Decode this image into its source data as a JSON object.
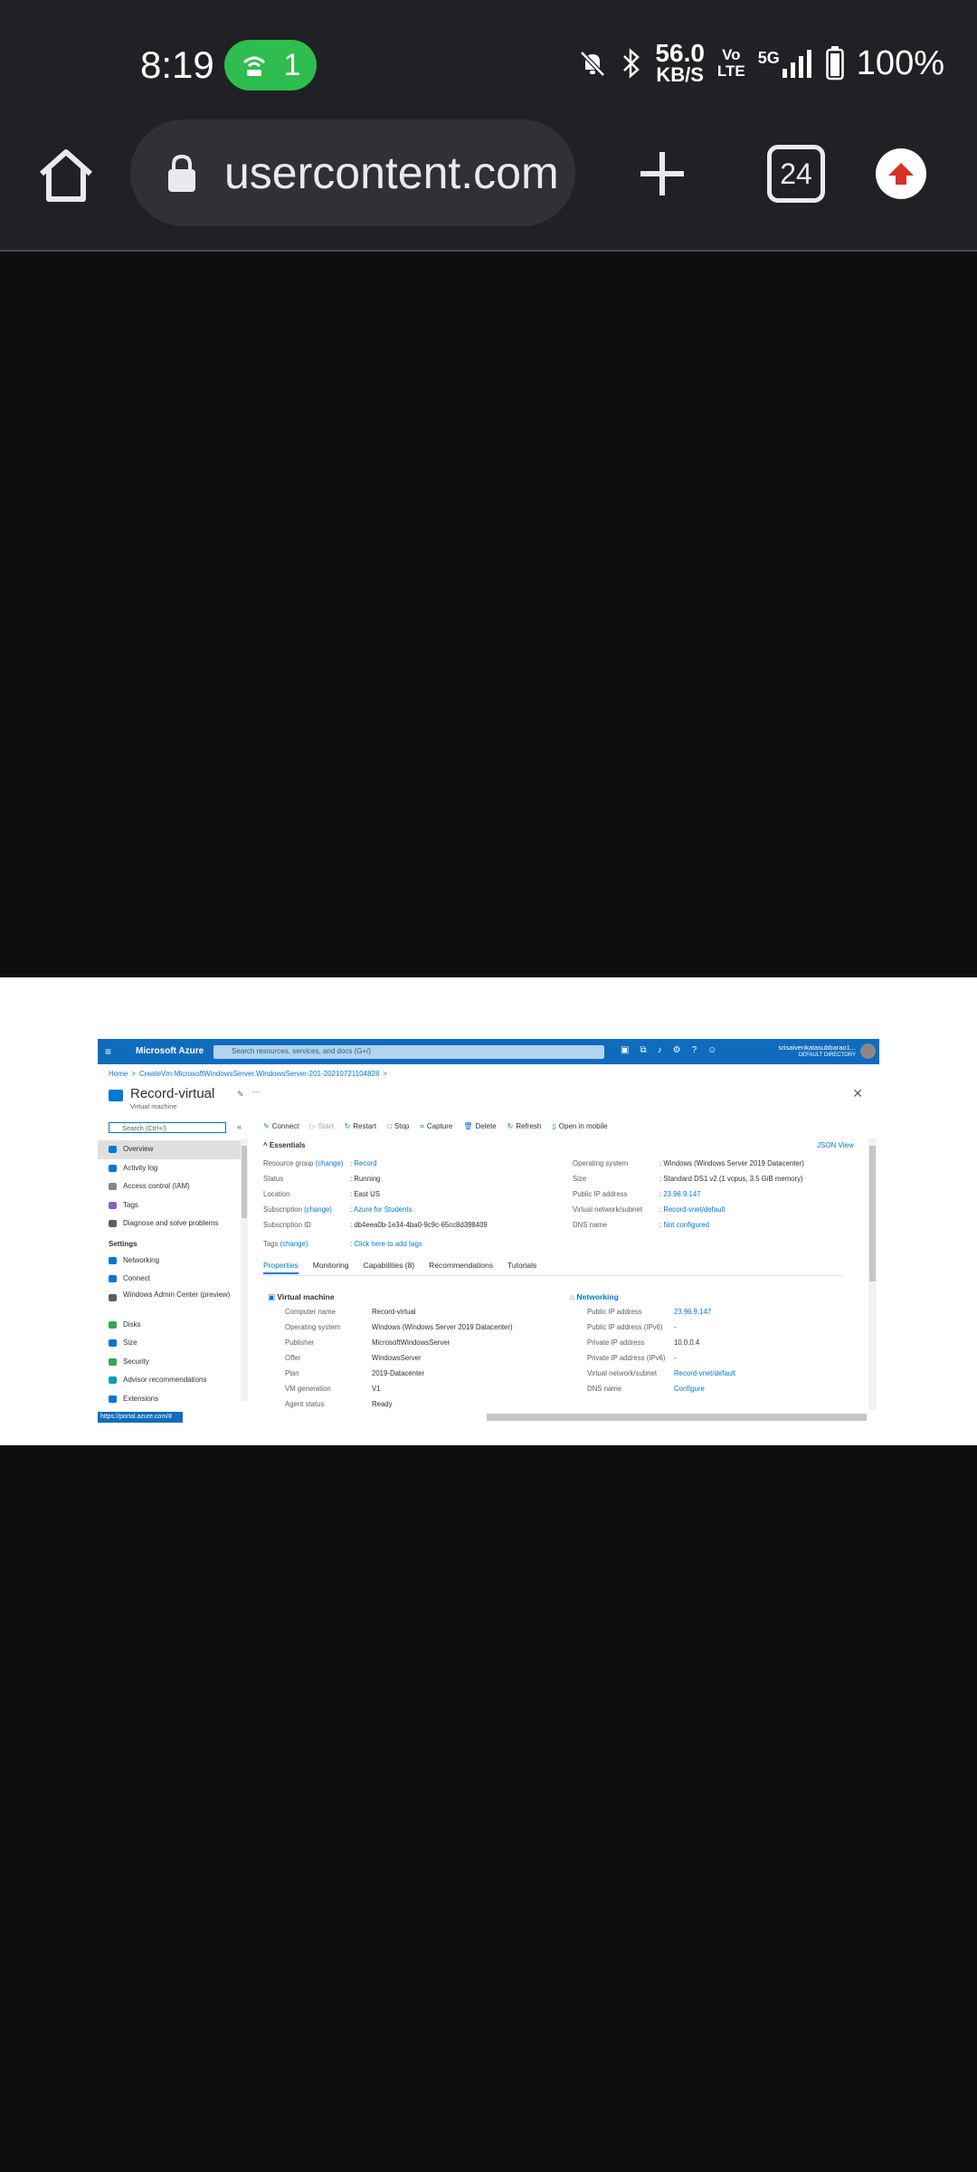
{
  "status_bar": {
    "time": "8:19",
    "hotspot_count": "1",
    "speed_value": "56.0",
    "speed_unit": "KB/S",
    "volte_top": "Vo",
    "volte_bottom": "LTE",
    "network": "5G",
    "battery": "100%"
  },
  "browser": {
    "url": "usercontent.com",
    "tab_count": "24"
  },
  "portal": {
    "brand": "Microsoft Azure",
    "search_placeholder": "Search resources, services, and docs (G+/)",
    "user_name": "srisaivenkatasubbarao1...",
    "user_directory": "DEFAULT DIRECTORY",
    "breadcrumb": [
      "Home",
      "CreateVm-MicrosoftWindowsServer.WindowsServer-201-20210721104828"
    ],
    "resource_title": "Record-virtual",
    "resource_subtitle": "Virtual machine",
    "nav_search_placeholder": "Search (Ctrl+/)",
    "nav_items": [
      "Overview",
      "Activity log",
      "Access control (IAM)",
      "Tags",
      "Diagnose and solve problems"
    ],
    "nav_settings_header": "Settings",
    "nav_settings_items": [
      "Networking",
      "Connect",
      "Windows Admin Center (preview)",
      "Disks",
      "Size",
      "Security",
      "Advisor recommendations",
      "Extensions"
    ],
    "commands": [
      "Connect",
      "Start",
      "Restart",
      "Stop",
      "Capture",
      "Delete",
      "Refresh",
      "Open in mobile"
    ],
    "essentials_title": "Essentials",
    "json_view": "JSON View",
    "essentials_left": [
      {
        "key": "Resource group",
        "change": "(change)",
        "value": "Record"
      },
      {
        "key": "Status",
        "value": "Running"
      },
      {
        "key": "Location",
        "value": "East US"
      },
      {
        "key": "Subscription",
        "change": "(change)",
        "value": "Azure for Students"
      },
      {
        "key": "Subscription ID",
        "value": "db4eea0b-1e34-4ba0-9c9c-65cc8d398409"
      },
      {
        "key": "Tags",
        "change": "(change)",
        "value": "Click here to add tags"
      }
    ],
    "essentials_right": [
      {
        "key": "Operating system",
        "value": "Windows (Windows Server 2019 Datacenter)"
      },
      {
        "key": "Size",
        "value": "Standard DS1 v2 (1 vcpus, 3.5 GiB memory)"
      },
      {
        "key": "Public IP address",
        "value": "23.96.9.147"
      },
      {
        "key": "Virtual network/subnet",
        "value": "Record-vnet/default"
      },
      {
        "key": "DNS name",
        "value": "Not configured"
      }
    ],
    "tabs": [
      "Properties",
      "Monitoring",
      "Capabilities (8)",
      "Recommendations",
      "Tutorials"
    ],
    "vm_section_title": "Virtual machine",
    "vm_props": [
      {
        "key": "Computer name",
        "value": "Record-virtual"
      },
      {
        "key": "Operating system",
        "value": "Windows (Windows Server 2019 Datacenter)"
      },
      {
        "key": "Publisher",
        "value": "MicrosoftWindowsServer"
      },
      {
        "key": "Offer",
        "value": "WindowsServer"
      },
      {
        "key": "Plan",
        "value": "2019-Datacenter"
      },
      {
        "key": "VM generation",
        "value": "V1"
      },
      {
        "key": "Agent status",
        "value": "Ready"
      }
    ],
    "net_section_title": "Networking",
    "net_props": [
      {
        "key": "Public IP address",
        "value": "23.96.9.147"
      },
      {
        "key": "Public IP address (IPv6)",
        "value": "-"
      },
      {
        "key": "Private IP address",
        "value": "10.0.0.4"
      },
      {
        "key": "Private IP address (IPv6)",
        "value": "-"
      },
      {
        "key": "Virtual network/subnet",
        "value": "Record-vnet/default"
      },
      {
        "key": "DNS name",
        "value": "Configure"
      }
    ],
    "status_url": "https://portal.azure.com/#"
  }
}
